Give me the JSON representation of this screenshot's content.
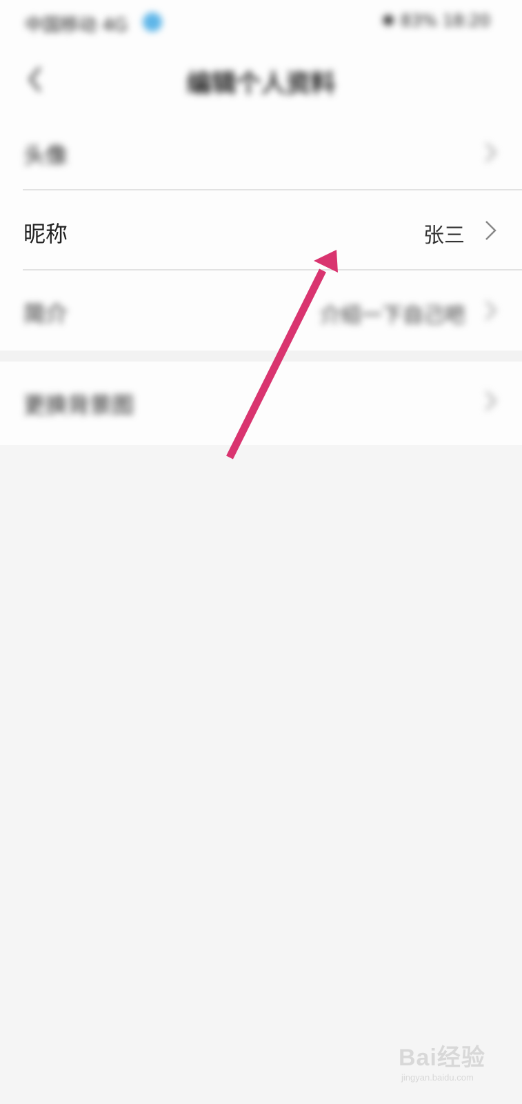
{
  "status_bar": {
    "left_text": "中国移动 4G",
    "right_text": "✱ 83% 18:20"
  },
  "header": {
    "title": "编辑个人资料"
  },
  "rows": [
    {
      "label": "头像",
      "value": ""
    },
    {
      "label": "昵称",
      "value": "张三"
    },
    {
      "label": "简介",
      "value": "介绍一下自己吧"
    },
    {
      "label": "更换背景图",
      "value": ""
    }
  ],
  "colors": {
    "annotation_arrow": "#d9346f",
    "background": "#f5f5f5",
    "panel": "#fdfdfd"
  },
  "watermark": {
    "main": "Bai经验",
    "sub": "jingyan.baidu.com"
  }
}
